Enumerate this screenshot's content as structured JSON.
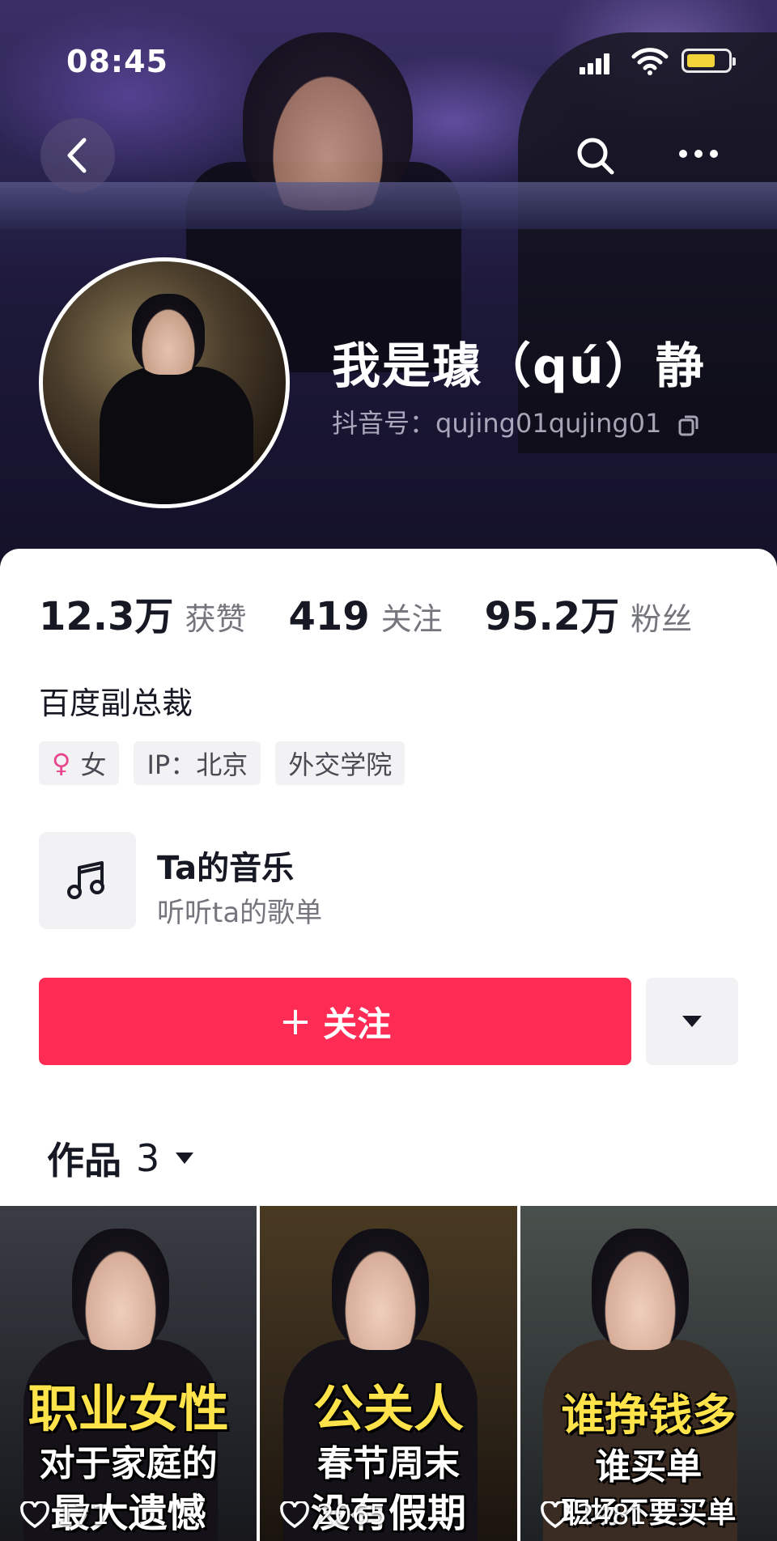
{
  "status_bar": {
    "time": "08:45"
  },
  "profile": {
    "username": "我是璩（qú）静",
    "douyin_id": "抖音号：qujing01qujing01"
  },
  "stats": [
    {
      "value": "12.3万",
      "label": "获赞"
    },
    {
      "value": "419",
      "label": "关注"
    },
    {
      "value": "95.2万",
      "label": "粉丝"
    }
  ],
  "bio": "百度副总裁",
  "tags": {
    "gender": "女",
    "ip": "IP：北京",
    "school": "外交学院"
  },
  "music": {
    "title": "Ta的音乐",
    "subtitle": "听听ta的歌单"
  },
  "follow_button": {
    "plus": "+",
    "label": "关注"
  },
  "works_tab": {
    "label": "作品",
    "count": "3"
  },
  "videos": [
    {
      "line1": "职业女性",
      "line2": "对于家庭的",
      "line3": "最大遗憾",
      "likes": "171"
    },
    {
      "line1": "公关人",
      "line2": "春节周末",
      "line3": "没有假期",
      "likes": "2065"
    },
    {
      "line1": "谁挣钱多",
      "line2": "谁买单",
      "line3": "职场不要买单",
      "likes": "2481"
    }
  ],
  "icons": {
    "back": "chevron-left-icon",
    "search": "search-icon",
    "more": "more-dots-icon",
    "copy": "copy-icon",
    "music": "music-note-icon",
    "dropdown": "caret-down-icon",
    "like": "heart-icon",
    "female": "female-icon"
  },
  "colors": {
    "accent": "#fe2c55",
    "female": "#e8468c",
    "caption_yellow": "#ffe34a"
  }
}
